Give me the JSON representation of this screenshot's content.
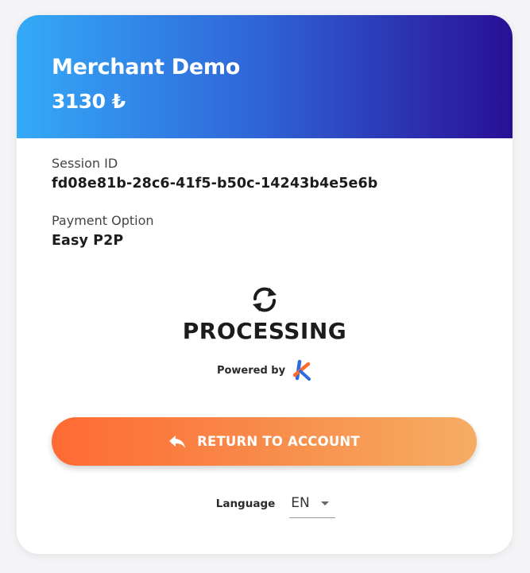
{
  "header": {
    "merchant_name": "Merchant Demo",
    "amount": "3130 ₺"
  },
  "session": {
    "label": "Session ID",
    "value": "fd08e81b-28c6-41f5-b50c-14243b4e5e6b"
  },
  "payment": {
    "label": "Payment Option",
    "value": "Easy P2P"
  },
  "status": {
    "icon": "refresh-icon",
    "text": "PROCESSING"
  },
  "powered_by": {
    "label": "Powered by",
    "logo_icon": "brand-logo-icon"
  },
  "return_button": {
    "label": "RETURN TO ACCOUNT",
    "icon": "reply-arrow-icon"
  },
  "language": {
    "label": "Language",
    "selected": "EN"
  },
  "colors": {
    "header_gradient_start": "#34aaf8",
    "header_gradient_end": "#2a0f95",
    "button_gradient_start": "#ff6a33",
    "button_gradient_end": "#f5ad63"
  }
}
